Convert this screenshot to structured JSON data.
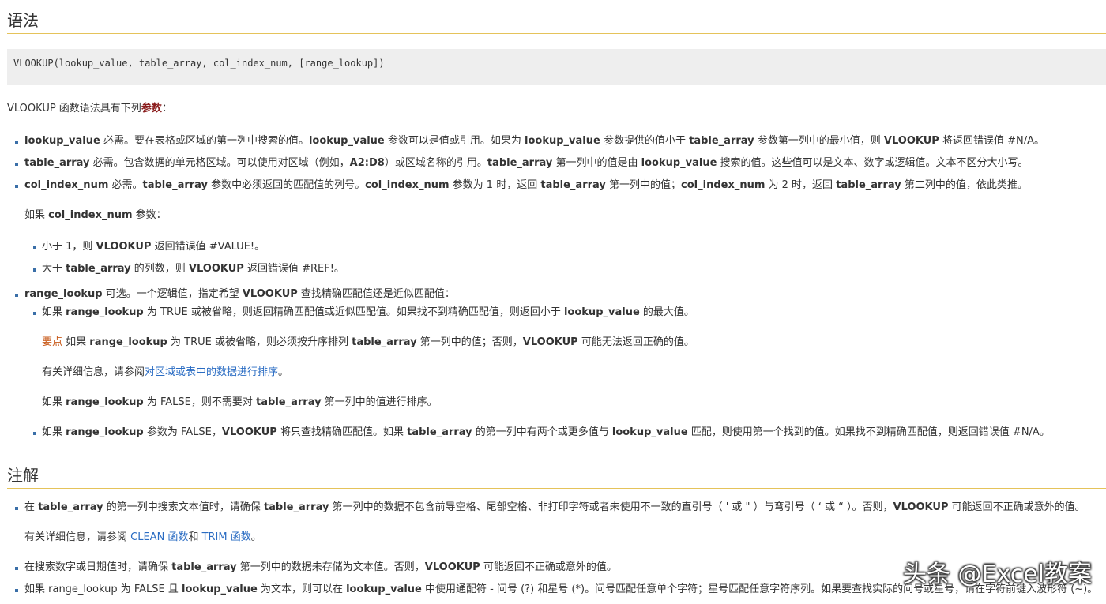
{
  "syntax": {
    "heading": "语法",
    "code": "VLOOKUP(lookup_value, table_array, col_index_num, [range_lookup])",
    "intro_prefix": "VLOOKUP 函数语法具有下列",
    "intro_key": "参数",
    "intro_suffix": "："
  },
  "params": {
    "p1": {
      "name": "lookup_value",
      "desc1": " 必需。要在表格或区域的第一列中搜索的值。",
      "b1": "lookup_value",
      "desc2": " 参数可以是值或引用。如果为 ",
      "b2": "lookup_value",
      "desc3": " 参数提供的值小于 ",
      "b3": "table_array",
      "desc4": " 参数第一列中的最小值，则 ",
      "b4": "VLOOKUP",
      "desc5": " 将返回错误值 #N/A。"
    },
    "p2": {
      "name": "table_array",
      "desc1": " 必需。包含数据的单元格区域。可以使用对区域（例如，",
      "b1": "A2:D8",
      "desc2": "）或区域名称的引用。",
      "b2": "table_array",
      "desc3": " 第一列中的值是由 ",
      "b3": "lookup_value",
      "desc4": " 搜索的值。这些值可以是文本、数字或逻辑值。文本不区分大小写。"
    },
    "p3": {
      "name": "col_index_num",
      "desc1": " 必需。",
      "b1": "table_array",
      "desc2": " 参数中必须返回的匹配值的列号。",
      "b2": "col_index_num",
      "desc3": " 参数为 1 时，返回 ",
      "b3": "table_array",
      "desc4": " 第一列中的值；",
      "b4": "col_index_num",
      "desc5": " 为 2 时，返回 ",
      "b5": "table_array",
      "desc6": " 第二列中的值，依此类推。"
    },
    "p3_if": {
      "pre": "如果 ",
      "b": "col_index_num",
      "post": " 参数："
    },
    "p3_s1": {
      "pre": "小于 1，则 ",
      "b": "VLOOKUP",
      "post": " 返回错误值 #VALUE!。"
    },
    "p3_s2": {
      "pre": "大于 ",
      "b1": "table_array",
      "mid": " 的列数，则 ",
      "b2": "VLOOKUP",
      "post": " 返回错误值 #REF!。"
    },
    "p4": {
      "name": "range_lookup",
      "desc1": " 可选。一个逻辑值，指定希望 ",
      "b1": "VLOOKUP",
      "desc2": " 查找精确匹配值还是近似匹配值："
    },
    "p4_s1": {
      "pre": "如果 ",
      "b1": "range_lookup",
      "mid": " 为 TRUE 或被省略，则返回精确匹配值或近似匹配值。如果找不到精确匹配值，则返回小于 ",
      "b2": "lookup_value",
      "post": " 的最大值。"
    },
    "p4_imp": {
      "label": "要点",
      "pre": "  如果 ",
      "b1": "range_lookup",
      "mid": " 为 TRUE 或被省略，则必须按升序排列 ",
      "b2": "table_array",
      "mid2": " 第一列中的值；否则，",
      "b3": "VLOOKUP",
      "post": " 可能无法返回正确的值。"
    },
    "p4_info": {
      "pre": "有关详细信息，请参阅",
      "link": "对区域或表中的数据进行排序",
      "post": "。"
    },
    "p4_false": {
      "pre": "如果 ",
      "b1": "range_lookup",
      "mid": " 为 FALSE，则不需要对 ",
      "b2": "table_array",
      "post": " 第一列中的值进行排序。"
    },
    "p4_s2": {
      "pre": "如果 ",
      "b1": "range_lookup",
      "mid": " 参数为 FALSE，",
      "b2": "VLOOKUP",
      "mid2": " 将只查找精确匹配值。如果 ",
      "b3": "table_array",
      "mid3": " 的第一列中有两个或更多值与 ",
      "b4": "lookup_value",
      "post": " 匹配，则使用第一个找到的值。如果找不到精确匹配值，则返回错误值 #N/A。"
    }
  },
  "notes": {
    "heading": "注解",
    "n1": {
      "pre": "在 ",
      "b1": "table_array",
      "mid": " 的第一列中搜索文本值时，请确保 ",
      "b2": "table_array",
      "mid2": " 第一列中的数据不包含前导空格、尾部空格、非打印字符或者未使用不一致的直引号（ ' 或 \" ）与弯引号（ ‘ 或 “ ）。否则，",
      "b3": "VLOOKUP",
      "post": " 可能返回不正确或意外的值。"
    },
    "n1_info": {
      "pre": "有关详细信息，请参阅 ",
      "link1": "CLEAN 函数",
      "mid": "和 ",
      "link2": "TRIM 函数",
      "post": "。"
    },
    "n2": {
      "pre": "在搜索数字或日期值时，请确保 ",
      "b1": "table_array",
      "mid": " 第一列中的数据未存储为文本值。否则，",
      "b2": "VLOOKUP",
      "post": " 可能返回不正确或意外的值。"
    },
    "n3": {
      "pre": "如果 range_lookup 为 FALSE 且 ",
      "b1": "lookup_value",
      "mid": " 为文本，则可以在 ",
      "b2": "lookup_value",
      "post": " 中使用通配符 - 问号 (?) 和星号 (*)。问号匹配任意单个字符；星号匹配任意字符序列。如果要查找实际的问号或星号，请在字符前键入波形符 (~)。"
    }
  },
  "watermark": "头条 @Excel教案"
}
